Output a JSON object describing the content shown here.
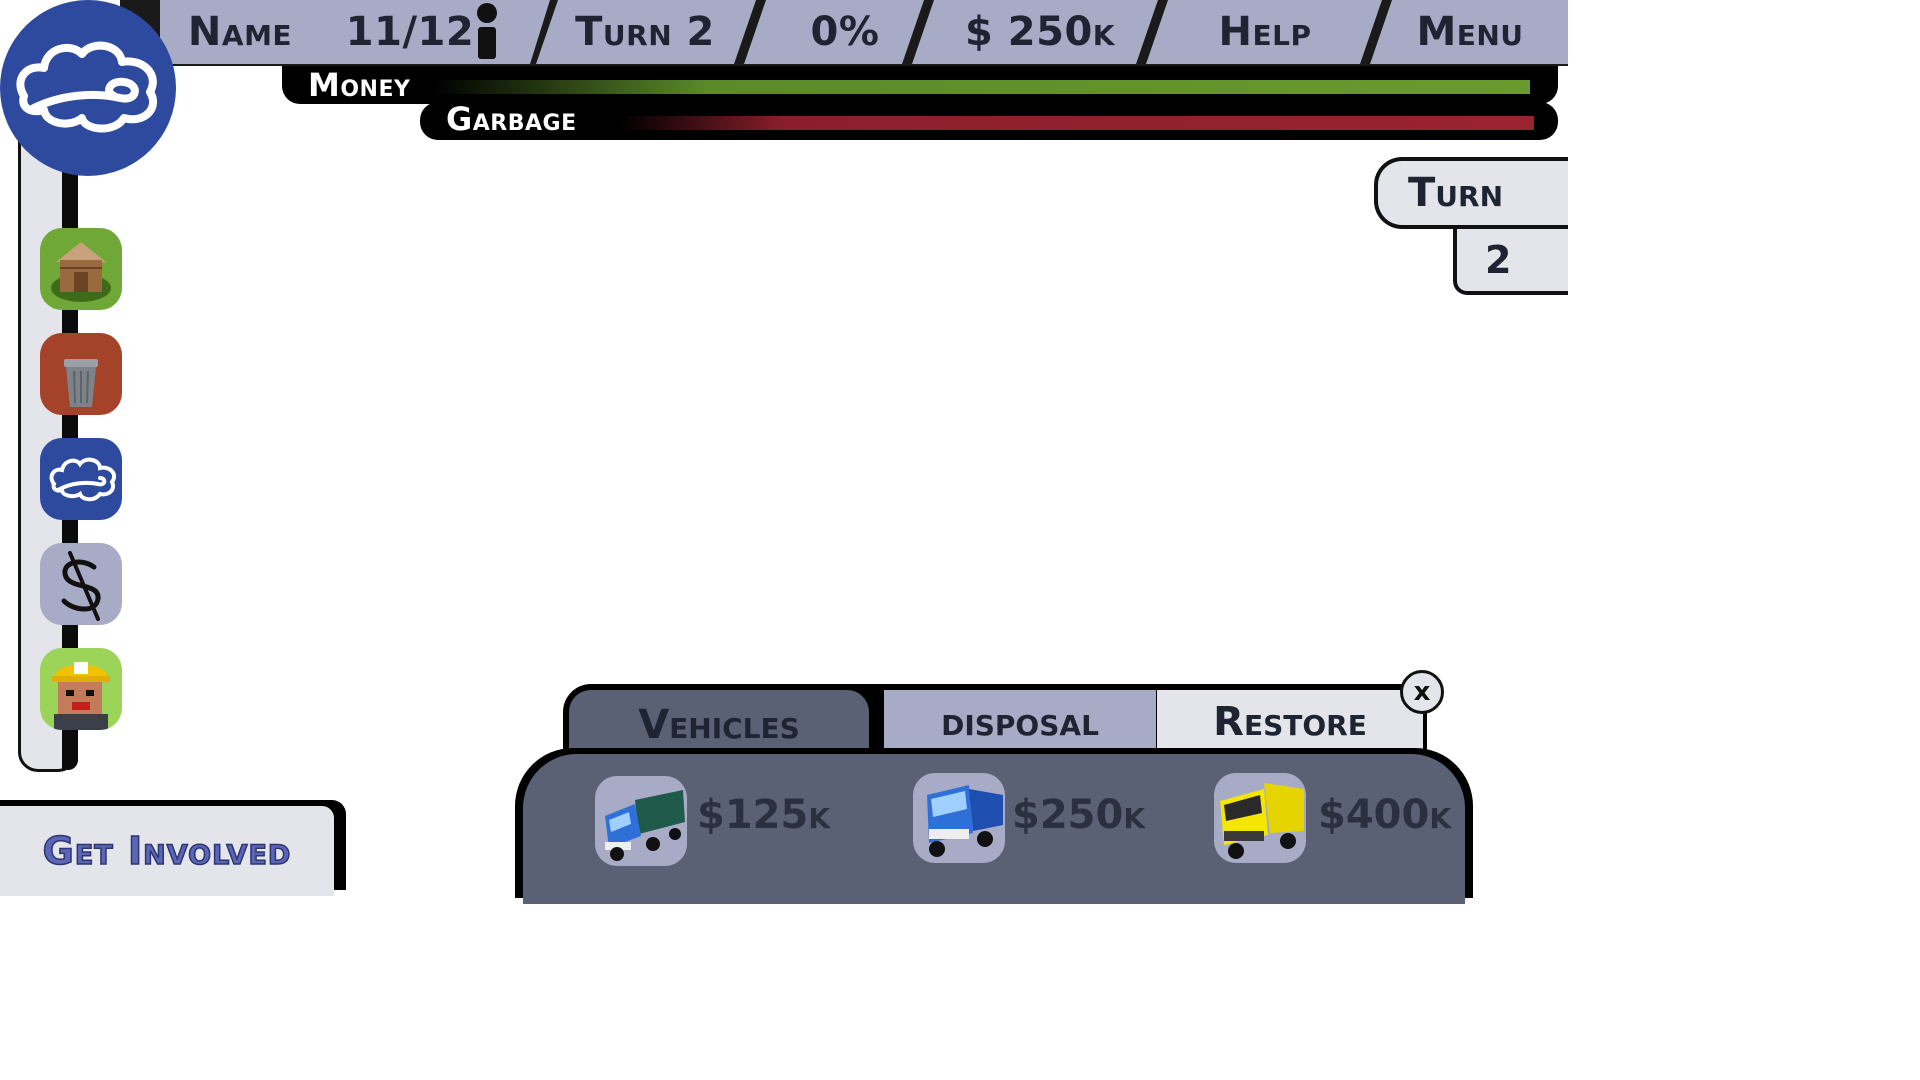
{
  "topbar": {
    "name_label": "Name",
    "population": "11/12",
    "turn_label": "Turn 2",
    "percent": "0%",
    "money": "$ 250k",
    "help_label": "Help",
    "menu_label": "Menu"
  },
  "bars": {
    "money_label": "Money",
    "garbage_label": "Garbage",
    "money_fill": 1.0,
    "garbage_fill": 1.0,
    "money_color": "#5a8a2a",
    "garbage_color": "#8a1f2b"
  },
  "turn_panel": {
    "label": "Turn",
    "value": "2"
  },
  "sidebar": {
    "items": [
      {
        "name": "house-icon"
      },
      {
        "name": "trash-can-icon"
      },
      {
        "name": "cloud-logo-icon"
      },
      {
        "name": "dollar-icon"
      },
      {
        "name": "worker-avatar-icon"
      }
    ]
  },
  "get_involved": "Get Involved",
  "shop": {
    "tabs": [
      "Vehicles",
      "disposal",
      "Restore"
    ],
    "close_label": "x",
    "vehicles": [
      {
        "icon": "green-truck-icon",
        "price": "$125k"
      },
      {
        "icon": "blue-truck-icon",
        "price": "$250k"
      },
      {
        "icon": "yellow-truck-icon",
        "price": "$400k"
      }
    ]
  },
  "colors": {
    "accent": "#2e4a9e",
    "panel": "#5b6175",
    "tab": "#a7abc5"
  }
}
